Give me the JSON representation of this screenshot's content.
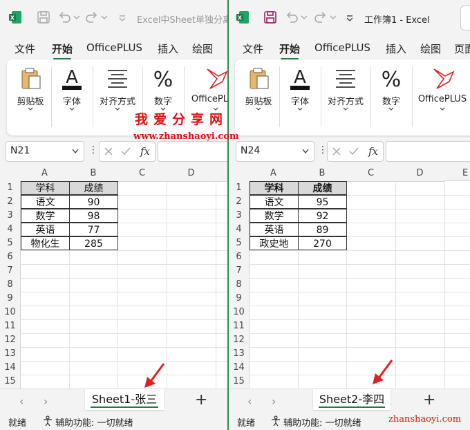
{
  "left_window": {
    "title": "Excel中Sheet单独分离",
    "tabs": [
      "文件",
      "开始",
      "OfficePLUS",
      "插入",
      "绘图"
    ],
    "ribbon": [
      "剪贴板",
      "字体",
      "对齐方式",
      "数字",
      "OfficePLUS"
    ],
    "name_box": "N21",
    "columns": [
      "A",
      "B",
      "C",
      "D"
    ],
    "rows": [
      "1",
      "2",
      "3",
      "4",
      "5",
      "6",
      "7",
      "8",
      "9",
      "10",
      "11",
      "12",
      "13",
      "14",
      "15"
    ],
    "table": {
      "header": [
        "学科",
        "成绩"
      ],
      "data": [
        [
          "语文",
          "90"
        ],
        [
          "数学",
          "98"
        ],
        [
          "英语",
          "77"
        ],
        [
          "物化生",
          "285"
        ]
      ]
    },
    "sheet_tab": "Sheet1-张三",
    "status_ready": "就绪",
    "status_access": "辅助功能: 一切就绪"
  },
  "right_window": {
    "title": "工作簿1  -  Excel",
    "tabs": [
      "文件",
      "开始",
      "OfficePLUS",
      "插入",
      "绘图",
      "页面"
    ],
    "ribbon": [
      "剪贴板",
      "字体",
      "对齐方式",
      "数字",
      "OfficePLUS"
    ],
    "name_box": "N24",
    "columns": [
      "A",
      "B",
      "C",
      "D",
      "E"
    ],
    "rows": [
      "1",
      "2",
      "3",
      "4",
      "5",
      "6",
      "7",
      "8",
      "9",
      "10",
      "11",
      "12",
      "13",
      "14",
      "15"
    ],
    "table": {
      "header": [
        "学科",
        "成绩"
      ],
      "data": [
        [
          "语文",
          "95"
        ],
        [
          "数学",
          "92"
        ],
        [
          "英语",
          "89"
        ],
        [
          "政史地",
          "270"
        ]
      ]
    },
    "sheet_tab": "Sheet2-李四",
    "status_ready": "就绪",
    "status_access": "辅助功能: 一切就绪"
  },
  "watermark": {
    "line1": "我爱分享网",
    "line2": "www.zhanshaoyi.com",
    "corner": "zhanshaoyi.com"
  },
  "colors": {
    "excel_green": "#1b7d3e",
    "accent_red": "#e01010"
  }
}
